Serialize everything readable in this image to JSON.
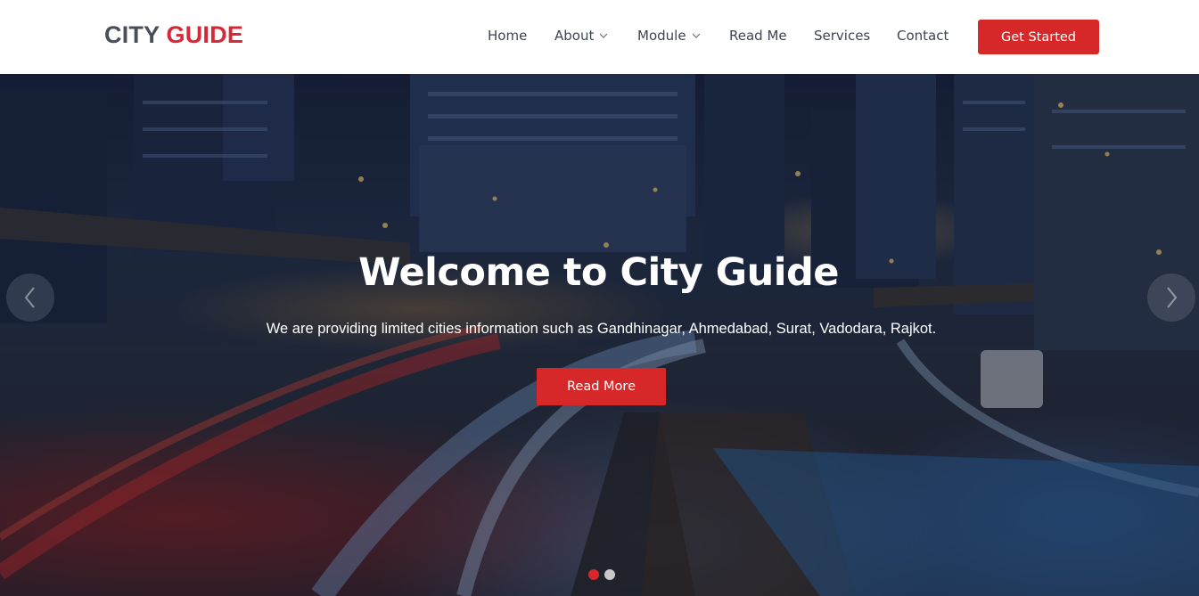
{
  "brand": {
    "part1": "CITY",
    "part2": "GUIDE"
  },
  "nav": {
    "items": [
      {
        "label": "Home",
        "dropdown": false
      },
      {
        "label": "About",
        "dropdown": true
      },
      {
        "label": "Module",
        "dropdown": true
      },
      {
        "label": "Read Me",
        "dropdown": false
      },
      {
        "label": "Services",
        "dropdown": false
      },
      {
        "label": "Contact",
        "dropdown": false
      }
    ],
    "cta_label": "Get Started"
  },
  "hero": {
    "title": "Welcome to City Guide",
    "subtitle": "We are providing limited cities information such as Gandhinagar, Ahmedabad, Surat, Vadodara, Rajkot.",
    "button_label": "Read More",
    "prev_icon": "chevron-left-icon",
    "next_icon": "chevron-right-icon",
    "slides_count": 2,
    "active_slide": 1
  },
  "colors": {
    "accent": "#d62829",
    "brand_dark": "#4a4e5a",
    "brand_red": "#d62839",
    "nav_text": "#3e4450",
    "dot_inactive": "#c9c9c9"
  }
}
